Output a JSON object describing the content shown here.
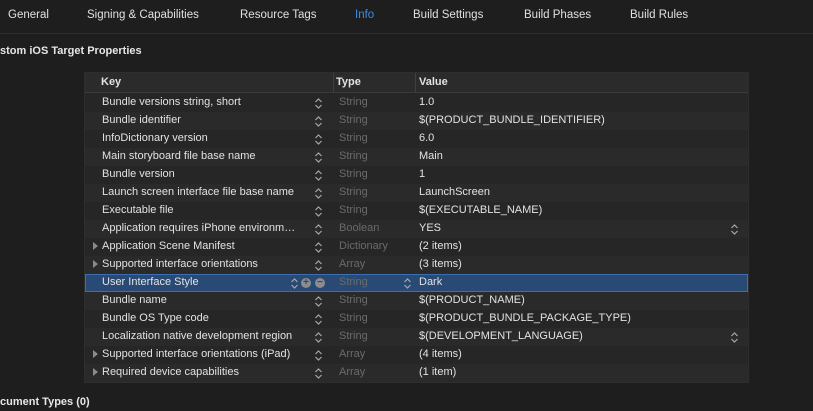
{
  "tabs": [
    {
      "label": "General",
      "active": false
    },
    {
      "label": "Signing & Capabilities",
      "active": false
    },
    {
      "label": "Resource Tags",
      "active": false
    },
    {
      "label": "Info",
      "active": true
    },
    {
      "label": "Build Settings",
      "active": false
    },
    {
      "label": "Build Phases",
      "active": false
    },
    {
      "label": "Build Rules",
      "active": false
    }
  ],
  "section_title": "stom iOS Target Properties",
  "table": {
    "headers": {
      "key": "Key",
      "type": "Type",
      "value": "Value"
    },
    "rows": [
      {
        "key": "Bundle versions string, short",
        "type": "String",
        "value": "1.0",
        "expandable": false
      },
      {
        "key": "Bundle identifier",
        "type": "String",
        "value": "$(PRODUCT_BUNDLE_IDENTIFIER)",
        "expandable": false
      },
      {
        "key": "InfoDictionary version",
        "type": "String",
        "value": "6.0",
        "expandable": false
      },
      {
        "key": "Main storyboard file base name",
        "type": "String",
        "value": "Main",
        "expandable": false
      },
      {
        "key": "Bundle version",
        "type": "String",
        "value": "1",
        "expandable": false
      },
      {
        "key": "Launch screen interface file base name",
        "type": "String",
        "value": "LaunchScreen",
        "expandable": false
      },
      {
        "key": "Executable file",
        "type": "String",
        "value": "$(EXECUTABLE_NAME)",
        "expandable": false
      },
      {
        "key": "Application requires iPhone environm…",
        "type": "Boolean",
        "value": "YES",
        "expandable": false,
        "value_stepper": true
      },
      {
        "key": "Application Scene Manifest",
        "type": "Dictionary",
        "value": "(2 items)",
        "expandable": true
      },
      {
        "key": "Supported interface orientations",
        "type": "Array",
        "value": "(3 items)",
        "expandable": true
      },
      {
        "key": "User Interface Style",
        "type": "String",
        "value": "Dark",
        "expandable": false,
        "selected": true
      },
      {
        "key": "Bundle name",
        "type": "String",
        "value": "$(PRODUCT_NAME)",
        "expandable": false
      },
      {
        "key": "Bundle OS Type code",
        "type": "String",
        "value": "$(PRODUCT_BUNDLE_PACKAGE_TYPE)",
        "expandable": false
      },
      {
        "key": "Localization native development region",
        "type": "String",
        "value": "$(DEVELOPMENT_LANGUAGE)",
        "expandable": false,
        "value_stepper": true
      },
      {
        "key": "Supported interface orientations (iPad)",
        "type": "Array",
        "value": "(4 items)",
        "expandable": true
      },
      {
        "key": "Required device capabilities",
        "type": "Array",
        "value": "(1 item)",
        "expandable": true
      }
    ]
  },
  "bottom_section_title": "cument Types (0)",
  "colors": {
    "accent": "#3a8ee6",
    "selected_row": "#284a75",
    "type_text": "#6b6b6b"
  }
}
